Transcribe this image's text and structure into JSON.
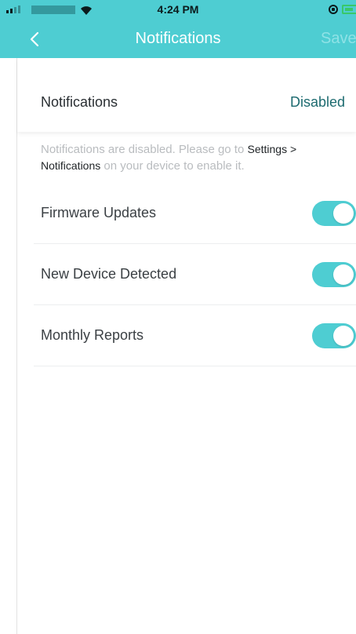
{
  "status_bar": {
    "time": "4:24 PM"
  },
  "nav": {
    "title": "Notifications",
    "save_label": "Save"
  },
  "notifications": {
    "label": "Notifications",
    "status": "Disabled"
  },
  "notice": {
    "part1": "Notifications are disabled. Please go to ",
    "path1": "Settings >",
    "path2": "Notifications",
    "part2": " on your device to enable it."
  },
  "settings": [
    {
      "label": "Firmware Updates",
      "enabled": true
    },
    {
      "label": "New Device Detected",
      "enabled": true
    },
    {
      "label": "Monthly Reports",
      "enabled": true
    }
  ],
  "colors": {
    "accent": "#4ecdd2",
    "status_link": "#1d6b70",
    "muted_text": "#b9bcbf"
  }
}
